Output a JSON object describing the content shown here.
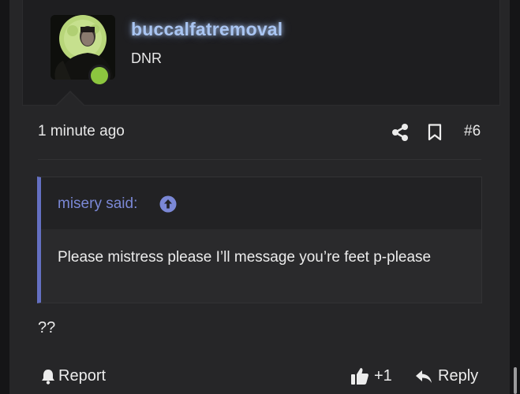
{
  "author": {
    "username": "buccalfatremoval",
    "user_title": "DNR",
    "avatar_icon": "avatar-photo",
    "status": "online",
    "status_color": "#8cc63f",
    "username_color": "#a9c5f2"
  },
  "post_meta": {
    "timestamp": "1 minute ago",
    "share_icon": "share-icon",
    "bookmark_icon": "bookmark-icon",
    "post_number": "#6"
  },
  "quote": {
    "author_label": "misery said:",
    "jump_icon": "arrow-up-circle-icon",
    "body": "Please mistress please I’ll message you’re feet p-please",
    "accent_color": "#6470c2"
  },
  "message": {
    "text": "??"
  },
  "actions": {
    "report_label": "Report",
    "like_label": "+1",
    "reply_label": "Reply"
  }
}
